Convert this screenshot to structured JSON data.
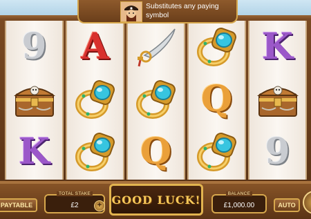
{
  "tooltip": {
    "text": "Substitutes any paying symbol",
    "icon": "pirate-portrait-icon"
  },
  "reels": [
    [
      "9",
      "A",
      "sword",
      "ring"
    ],
    [
      "chest",
      "ring",
      "ring",
      "Q"
    ],
    [
      "K",
      "ring",
      "Q",
      "ring"
    ]
  ],
  "grid": [
    [
      "9",
      "A",
      "sword",
      "ring",
      "K"
    ],
    [
      "chest",
      "ring",
      "ring",
      "Q",
      "chest"
    ],
    [
      "K",
      "ring",
      "Q",
      "ring",
      "9"
    ]
  ],
  "controls": {
    "paytable_label": "PAYTABLE",
    "total_stake_label": "TOTAL STAKE",
    "total_stake_value": "£2",
    "message": "GOOD LUCK!",
    "balance_label": "BALANCE",
    "balance_value": "£1,000.00",
    "auto_label": "AUTO",
    "minus_label": "−",
    "plus_label": "+"
  },
  "colors": {
    "wood": "#7a4a22",
    "gold": "#d7a84d",
    "reel_bg": "#fbf7f2"
  }
}
